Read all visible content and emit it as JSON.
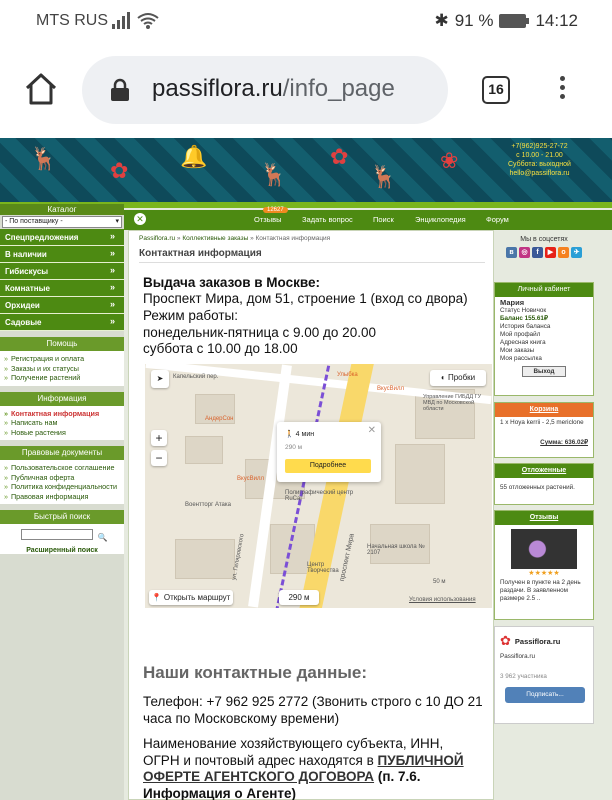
{
  "status": {
    "carrier": "MTS RUS",
    "battery": "91 %",
    "time": "14:12"
  },
  "browser": {
    "url_host": "passiflora.ru",
    "url_path": "/info_page",
    "tab_count": "16"
  },
  "banner": {
    "contact": "+7(962)925-27-72\nс 10.00 - 21.00\nСуббота: выходной\nhello@passiflora.ru"
  },
  "left": {
    "catalog_label": "Каталог",
    "select_value": "- По поставщику -",
    "groups": [
      "Спецпредложения",
      "В наличии",
      "Гибискусы",
      "Комнатные",
      "Орхидеи",
      "Садовые"
    ],
    "help_title": "Помощь",
    "help_items": [
      "Регистрация и оплата",
      "Заказы и их статусы",
      "Получение растений"
    ],
    "info_title": "Информация",
    "info_items": [
      "Контактная информация",
      "Написать нам",
      "Новые растения"
    ],
    "legal_title": "Правовые документы",
    "legal_items": [
      "Пользовательское соглашение",
      "Публичная оферта",
      "Политика конфиденциальности",
      "Правовая информация"
    ],
    "search_title": "Быстрый поиск",
    "search_adv": "Расширенный поиск"
  },
  "topnav": {
    "items": [
      "Отзывы",
      "Задать вопрос",
      "Поиск",
      "Энциклопедия",
      "Форум"
    ],
    "badge": "12627"
  },
  "content": {
    "breadcrumb_home": "Passiflora.ru",
    "breadcrumb_mid": "Коллективные заказы",
    "breadcrumb_cur": "Контактная информация",
    "title": "Контактная информация",
    "h1": "Выдача заказов в Москве:",
    "l1": "Проспект Мира, дом 51, строение 1 (вход со двора)",
    "l2": "Режим работы:",
    "l3": "понедельник-пятница с 9.00 до 20.00",
    "l4": "суббота с 10.00 до 18.00",
    "contacts_h": "Наши контактные данные:",
    "phone": "Телефон: +7 962 925 2772 (Звонить строго с 10 ДО 21 часа по Московскому времени)",
    "legal_pre": "Наименование хозяйствующего субъекта, ИНН, ОГРН и почтовый адрес находятся в",
    "legal_link": "ПУБЛИЧНОЙ ОФЕРТЕ АГЕНТСКОГО ДОГОВОРА",
    "legal_post": "(п. 7.6. Информация о Агенте)"
  },
  "map": {
    "probki": "Пробки",
    "walk": "4 мин",
    "dist": "290 м",
    "more": "Подробнее",
    "route": "Открыть маршрут",
    "route_dist": "290 м",
    "scale": "50 м",
    "terms": "Условия использования",
    "labels": [
      "Капельский пер.",
      "АндерСон",
      "ВкусВилл",
      "ВкусВилл",
      "Полиграфический центр RuCal",
      "проспект Мира",
      "ул. Гиляровского",
      "Управление ГИБДД ГУ МВД по Московской области",
      "Начальная школа № 2107",
      "Воентторг Атака",
      "Улыбка",
      "Центр Творчества"
    ]
  },
  "right": {
    "social_title": "Мы в соцсетях",
    "cab_title": "Личный кабинет",
    "cab_name": "Мария",
    "cab_status": "Статус Новичок",
    "cab_balance": "Баланс 155.61₽",
    "cab_links": [
      "История баланса",
      "Мой профайл",
      "Адресная книга",
      "Мои заказы",
      "Моя рассылка"
    ],
    "exit": "Выход",
    "cart_title": "Корзина",
    "cart_item": "1 x Hoya kerrii - 2,5 mericlone",
    "cart_sum": "Сумма: 636.02₽",
    "deferred_title": "Отложенные",
    "deferred_text": "55 отложенных растений.",
    "reviews_title": "Отзывы",
    "review_text": "Получен в пункте на 2 день раздачи. В заявленном размере 2.5 ..",
    "vk_name": "Passiflora.ru",
    "vk_sub": "Passiflora.ru",
    "vk_members": "3 962 участника",
    "vk_btn": "Подписать..."
  }
}
